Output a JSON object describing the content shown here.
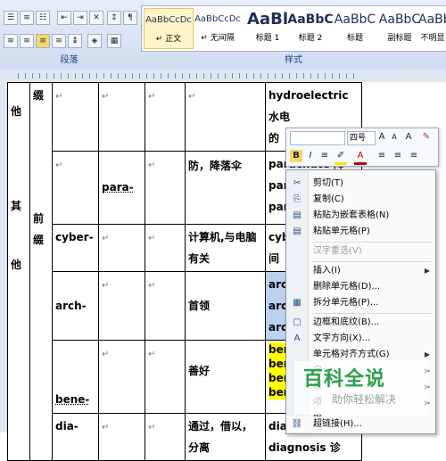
{
  "ribbon": {
    "paragraph_label": "段落",
    "styles_label": "样式",
    "styles": [
      {
        "sample": "AaBbCcDc",
        "name": "↵ 正文",
        "selected": true
      },
      {
        "sample": "AaBbCcDc",
        "name": "↵ 无间隔",
        "selected": false
      },
      {
        "sample": "AaBl",
        "name": "标题 1",
        "selected": false
      },
      {
        "sample": "AaBbC",
        "name": "标题 2",
        "selected": false
      },
      {
        "sample": "AaBbC",
        "name": "标题",
        "selected": false
      },
      {
        "sample": "AaBbC",
        "name": "副标题",
        "selected": false
      },
      {
        "sample": "AaBbC",
        "name": "不明显",
        "selected": false
      }
    ]
  },
  "table": {
    "col1": [
      "他",
      "其",
      "他"
    ],
    "col2": [
      "缀",
      "前",
      "缀"
    ],
    "rows": [
      {
        "prefix": "",
        "meaning": "",
        "examples": [
          "hydroelectric 水电",
          "的"
        ]
      },
      {
        "prefix": "para-",
        "meaning": "防，降落伞",
        "examples": [
          "parachute 降",
          "parasol 阳伞",
          "paratroop 伞"
        ]
      },
      {
        "prefix": "cyber-",
        "meaning": "计算机,与电脑有关",
        "examples": [
          "cyberspace",
          "间"
        ]
      },
      {
        "prefix": "arch-",
        "meaning": "首领",
        "examples": [
          "archbishop",
          "architect 建",
          "architecture"
        ]
      },
      {
        "prefix": "bene-",
        "meaning": "善好",
        "examples": [
          "benefit 利益",
          "benevolence",
          "beneficent 慈",
          "benefactor"
        ]
      },
      {
        "prefix": "dia-",
        "meaning": "通过，借以，分离",
        "examples": [
          "diagraph 绘",
          "diagnosis 诊"
        ]
      }
    ]
  },
  "mini_toolbar": {
    "font_size": "四号",
    "buttons": [
      "A",
      "A",
      "A",
      "A",
      "B",
      "I",
      "≡",
      "A",
      "≡",
      "≡",
      "≡"
    ]
  },
  "context_menu": {
    "items": [
      {
        "label": "剪切(T)",
        "icon": "✂",
        "disabled": false,
        "submenu": false
      },
      {
        "label": "复制(C)",
        "icon": "⎘",
        "disabled": false,
        "submenu": false
      },
      {
        "label": "粘贴为嵌套表格(N)",
        "icon": "▤",
        "disabled": false,
        "submenu": false
      },
      {
        "label": "粘贴单元格(P)",
        "icon": "▤",
        "disabled": false,
        "submenu": false
      },
      {
        "label": "汉字重选(V)",
        "icon": "",
        "disabled": true,
        "submenu": false
      },
      {
        "label": "插入(I)",
        "icon": "",
        "disabled": false,
        "submenu": true
      },
      {
        "label": "删除单元格(D)...",
        "icon": "",
        "disabled": false,
        "submenu": false
      },
      {
        "label": "拆分单元格(P)...",
        "icon": "▦",
        "disabled": false,
        "submenu": false
      },
      {
        "label": "边框和底纹(B)...",
        "icon": "▢",
        "disabled": false,
        "submenu": false
      },
      {
        "label": "文字方向(X)...",
        "icon": "A",
        "disabled": false,
        "submenu": false
      },
      {
        "label": "单元格对齐方式(G)",
        "icon": "",
        "disabled": false,
        "submenu": true
      },
      {
        "label": "自",
        "icon": "",
        "disabled": false,
        "submenu": true
      },
      {
        "label": "表",
        "icon": "",
        "disabled": false,
        "submenu": true
      },
      {
        "label": "项",
        "icon": "",
        "disabled": false,
        "submenu": true
      },
      {
        "label": "编",
        "icon": "",
        "disabled": false,
        "submenu": true
      },
      {
        "label": "超链接(H)...",
        "icon": "⛓",
        "disabled": false,
        "submenu": false
      }
    ]
  },
  "watermark": {
    "title": "百科全说",
    "subtitle": "助你轻松解决"
  }
}
